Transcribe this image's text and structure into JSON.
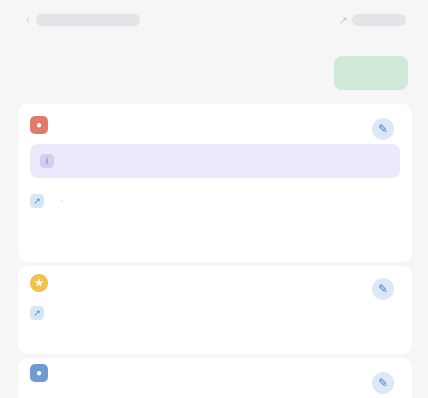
{
  "topbar": {
    "left_text": "",
    "right_text": ""
  },
  "header": {
    "title": "",
    "primary_button": ""
  },
  "items": [
    {
      "badge_color": "#e07b6b",
      "name": "",
      "subtitle": "",
      "notice": {
        "text": "",
        "end_text": ""
      },
      "links": [
        "",
        ""
      ]
    },
    {
      "badge_color": "#f2c14e",
      "name": "",
      "subtitle": "",
      "links": [
        ""
      ]
    },
    {
      "badge_color": "#6f9bd1",
      "name": "",
      "subtitle": ""
    }
  ],
  "colors": {
    "background": "#f6f6f7",
    "card": "#ffffff",
    "primary_button": "#cfe9d8",
    "notice_bg": "#ebe9fb",
    "accent_blue": "#6f9bd1"
  }
}
